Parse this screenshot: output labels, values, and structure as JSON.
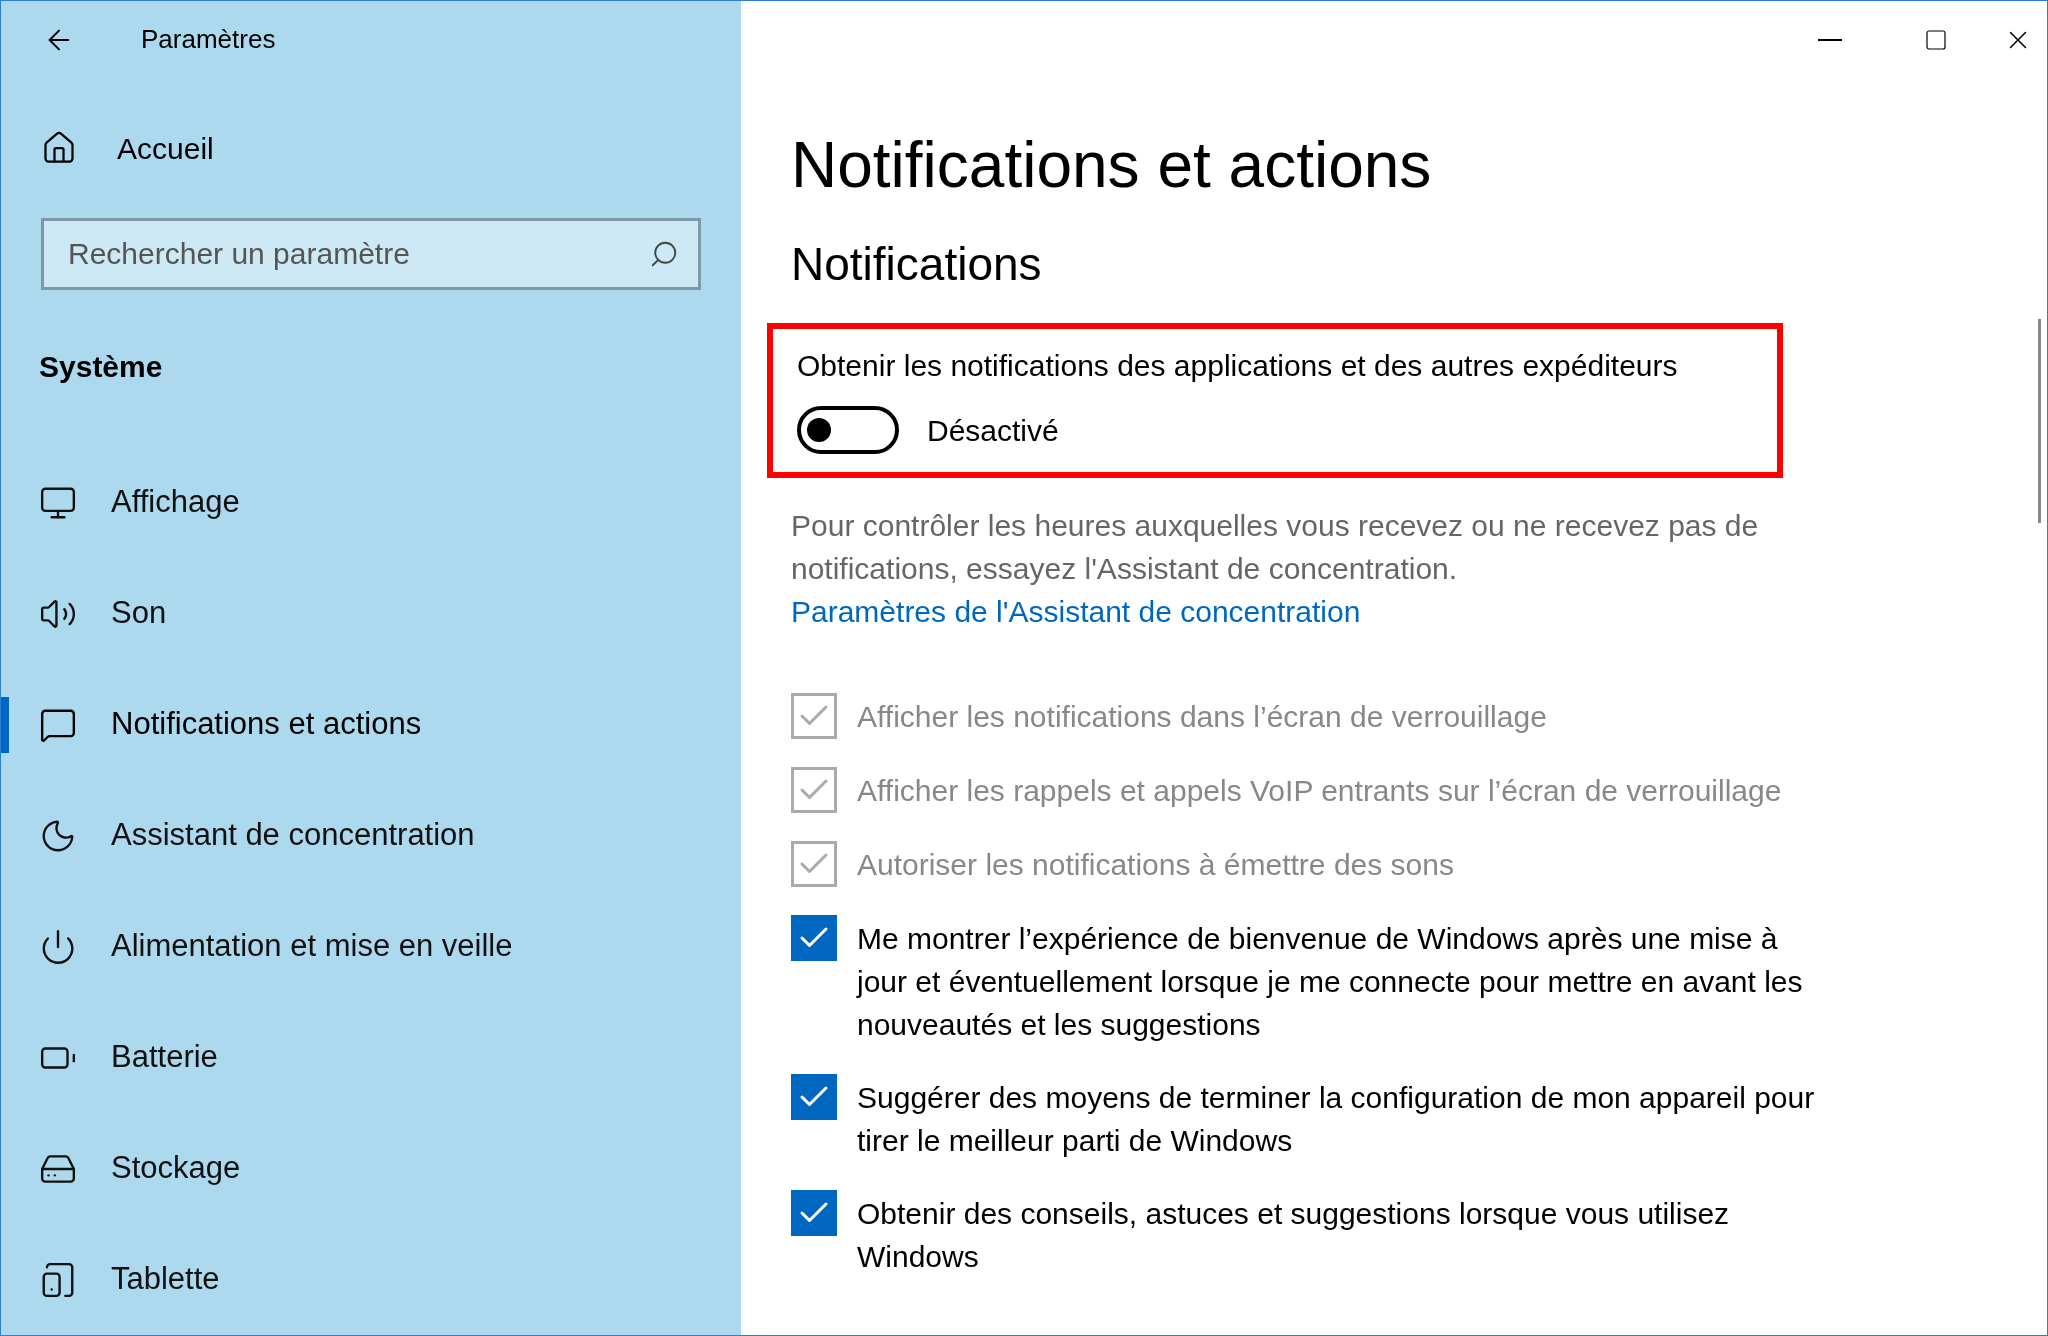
{
  "window": {
    "title": "Paramètres"
  },
  "sidebar": {
    "home": "Accueil",
    "search": {
      "placeholder": "Rechercher un paramètre"
    },
    "section": "Système",
    "items": [
      {
        "label": "Affichage",
        "selected": false
      },
      {
        "label": "Son",
        "selected": false
      },
      {
        "label": "Notifications et actions",
        "selected": true
      },
      {
        "label": "Assistant de concentration",
        "selected": false
      },
      {
        "label": "Alimentation et mise en veille",
        "selected": false
      },
      {
        "label": "Batterie",
        "selected": false
      },
      {
        "label": "Stockage",
        "selected": false
      },
      {
        "label": "Tablette",
        "selected": false
      }
    ]
  },
  "main": {
    "title": "Notifications et actions",
    "section": "Notifications",
    "toggle": {
      "label": "Obtenir les notifications des applications et des autres expéditeurs",
      "on": false,
      "state": "Désactivé"
    },
    "description": "Pour contrôler les heures auxquelles vous recevez ou ne recevez pas de notifications, essayez l'Assistant de concentration.",
    "link": "Paramètres de l'Assistant de concentration",
    "checkboxes": [
      {
        "label": "Afficher les notifications dans l’écran de verrouillage",
        "checked": true,
        "disabled": true
      },
      {
        "label": "Afficher les rappels et appels VoIP entrants sur l’écran de verrouillage",
        "checked": true,
        "disabled": true
      },
      {
        "label": "Autoriser les notifications à émettre des sons",
        "checked": true,
        "disabled": true
      },
      {
        "label": "Me montrer l’expérience de bienvenue de Windows après une mise à jour et éventuellement lorsque je me connecte pour mettre en avant les nouveautés et les suggestions",
        "checked": true,
        "disabled": false
      },
      {
        "label": "Suggérer des moyens de terminer la configuration de mon appareil pour tirer le meilleur parti de Windows",
        "checked": true,
        "disabled": false
      },
      {
        "label": "Obtenir des conseils, astuces et suggestions lorsque vous utilisez Windows",
        "checked": true,
        "disabled": false
      }
    ]
  }
}
